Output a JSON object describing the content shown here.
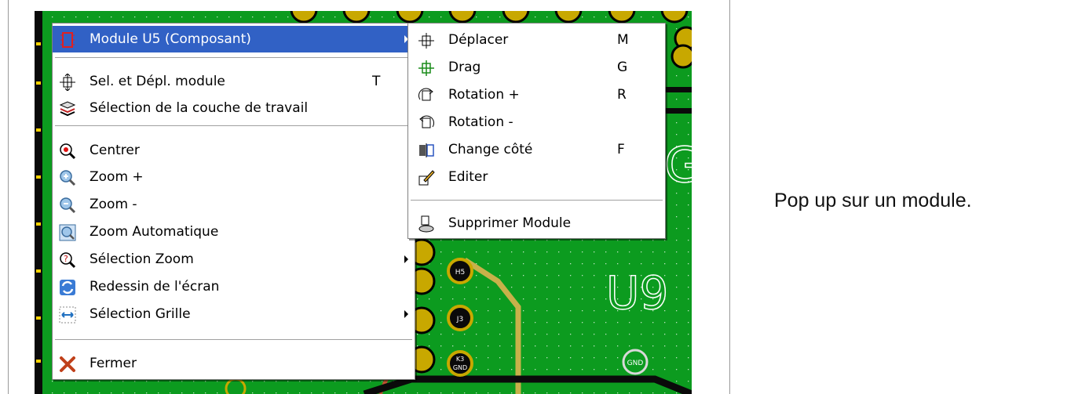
{
  "caption": "Pop up sur un module.",
  "board_labels": {
    "pad_h5": "H5",
    "pad_j3": "J3",
    "pad_gnd": "GND",
    "pad_k3": "K3",
    "silk_u9": "U9",
    "silk_g": "G"
  },
  "main_menu": {
    "items": [
      {
        "label": "Module U5 (Composant)",
        "icon": "chip-icon",
        "submenu": true,
        "highlighted": true
      },
      {
        "label": "Sel. et Dépl. module",
        "icon": "move-module-icon",
        "shortcut": "T"
      },
      {
        "label": "Sélection de la couche de travail",
        "icon": "layers-icon"
      },
      {
        "label": "Centrer",
        "icon": "center-icon"
      },
      {
        "label": "Zoom +",
        "icon": "zoom-in-icon"
      },
      {
        "label": "Zoom -",
        "icon": "zoom-out-icon"
      },
      {
        "label": "Zoom Automatique",
        "icon": "zoom-auto-icon"
      },
      {
        "label": "Sélection Zoom",
        "icon": "zoom-select-icon",
        "submenu": true
      },
      {
        "label": "Redessin de l'écran",
        "icon": "redraw-icon"
      },
      {
        "label": "Sélection Grille",
        "icon": "grid-icon",
        "submenu": true
      },
      {
        "label": "Fermer",
        "icon": "close-icon"
      }
    ]
  },
  "sub_menu": {
    "items": [
      {
        "label": "Déplacer",
        "icon": "move-icon",
        "shortcut": "M"
      },
      {
        "label": "Drag",
        "icon": "drag-icon",
        "shortcut": "G"
      },
      {
        "label": "Rotation +",
        "icon": "rotate-cw-icon",
        "shortcut": "R"
      },
      {
        "label": "Rotation -",
        "icon": "rotate-ccw-icon"
      },
      {
        "label": "Change côté",
        "icon": "flip-side-icon",
        "shortcut": "F"
      },
      {
        "label": "Editer",
        "icon": "edit-icon"
      },
      {
        "label": "Supprimer Module",
        "icon": "delete-module-icon"
      }
    ]
  },
  "colors": {
    "board": "#0c9b1f",
    "highlight": "#3161c5",
    "pad": "#c8a800",
    "track": "#c8b14a"
  }
}
